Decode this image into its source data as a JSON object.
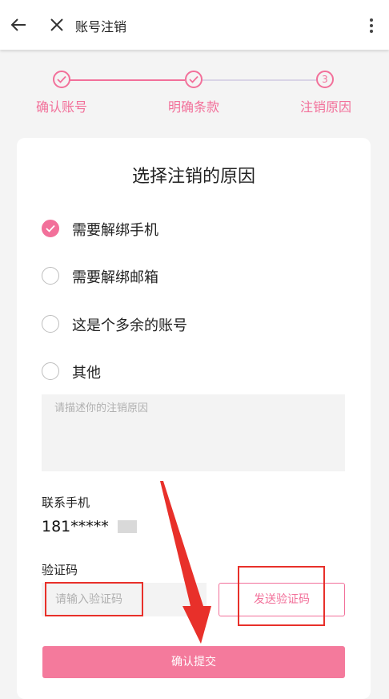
{
  "header": {
    "title": "账号注销",
    "back_icon": "arrow-left-icon",
    "close_icon": "close-icon",
    "more_icon": "more-vertical-icon"
  },
  "steps": [
    {
      "label": "确认账号",
      "state": "done"
    },
    {
      "label": "明确条款",
      "state": "done"
    },
    {
      "label": "注销原因",
      "state": "current",
      "number": "3"
    }
  ],
  "card": {
    "title": "选择注销的原因",
    "options": [
      {
        "label": "需要解绑手机",
        "checked": true
      },
      {
        "label": "需要解绑邮箱",
        "checked": false
      },
      {
        "label": "这是个多余的账号",
        "checked": false
      },
      {
        "label": "其他",
        "checked": false
      }
    ],
    "description_placeholder": "请描述你的注销原因",
    "phone_label": "联系手机",
    "phone_value": "181*****",
    "code_label": "验证码",
    "code_placeholder": "请输入验证码",
    "send_code_label": "发送验证码",
    "submit_label": "确认提交"
  },
  "colors": {
    "accent": "#f2709a",
    "submit_bg": "#f47a9c",
    "annotation_red": "#e8302a",
    "inactive_line": "#d9d4e6"
  }
}
